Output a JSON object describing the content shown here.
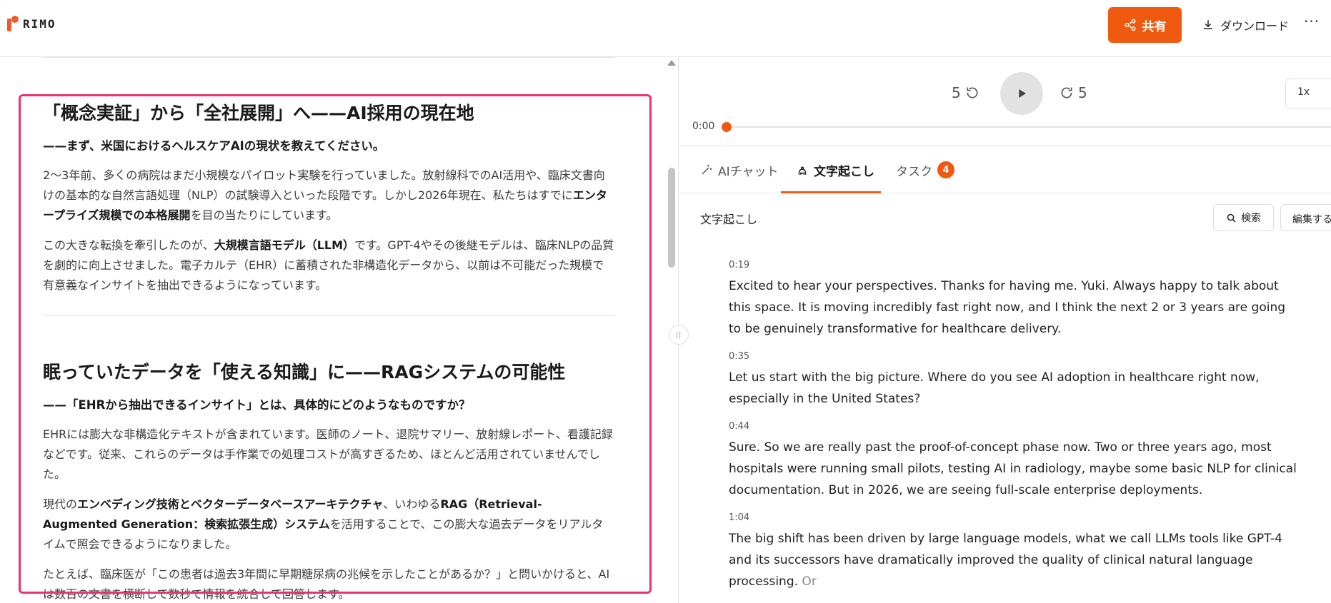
{
  "header": {
    "logo_text": "RIMO",
    "share_label": "共有",
    "download_label": "ダウンロード",
    "more_label": "···"
  },
  "article": {
    "section1": {
      "heading": "「概念実証」から「全社展開」へ——AI採用の現在地",
      "question": "——まず、米国におけるヘルスケアAIの現状を教えてください。",
      "p1_a": "2〜3年前、多くの病院はまだ小規模なパイロット実験を行っていました。放射線科でのAI活用や、臨床文書向けの基本的な自然言語処理（NLP）の試験導入といった段階です。しかし2026年現在、私たちはすでに",
      "p1_b": "エンタープライズ規模での本格展開",
      "p1_c": "を目の当たりにしています。",
      "p2_a": "この大きな転換を牽引したのが、",
      "p2_b": "大規模言語モデル（LLM）",
      "p2_c": "です。GPT-4やその後継モデルは、臨床NLPの品質を劇的に向上させました。電子カルテ（EHR）に蓄積された非構造化データから、以前は不可能だった規模で有意義なインサイトを抽出できるようになっています。"
    },
    "section2": {
      "heading": "眠っていたデータを「使える知識」に——RAGシステムの可能性",
      "question": "——「EHRから抽出できるインサイト」とは、具体的にどのようなものですか？",
      "p1": "EHRには膨大な非構造化テキストが含まれています。医師のノート、退院サマリー、放射線レポート、看護記録などです。従来、これらのデータは手作業での処理コストが高すぎるため、ほとんど活用されていませんでした。",
      "p2_a": "現代の",
      "p2_b": "エンベディング技術とベクターデータベースアーキテクチャ",
      "p2_c": "、いわゆる",
      "p2_d": "RAG（Retrieval-Augmented Generation：検索拡張生成）システム",
      "p2_e": "を活用することで、この膨大な過去データをリアルタイムで照会できるようになりました。",
      "p3": "たとえば、臨床医が「この患者は過去3年間に早期糖尿病の兆候を示したことがあるか？」と問いかけると、AIは数百の文書を横断して数秒で情報を統合して回答します。"
    }
  },
  "player": {
    "skip_back": "5",
    "skip_forward": "5",
    "speed": "1x",
    "current_time": "0:00",
    "progress": 0.0
  },
  "tabs": [
    {
      "label": "AIチャット"
    },
    {
      "label": "文字起こし"
    },
    {
      "label": "タスク",
      "badge": "4"
    }
  ],
  "transcript_panel": {
    "title": "文字起こし",
    "search_label": "検索",
    "edit_label": "編集する"
  },
  "segments": [
    {
      "time": "0:19",
      "text": "Excited to hear your perspectives. Thanks for having me. Yuki. Always happy to talk about this space. It is moving incredibly fast right now, and I think the next 2 or 3 years are going to be genuinely transformative for healthcare delivery."
    },
    {
      "time": "0:35",
      "text": " Let us start with the big picture. Where do you see AI adoption in healthcare right now, especially in the United States?"
    },
    {
      "time": "0:44",
      "text_a": " Sure. So we are really past the proof-of-concept phase now. ",
      "text_b": "Two or three years ago, most hospitals were running small pilots, testing AI in radiology, maybe some basic NLP for clinical documentation.",
      "text_c": " But in 2026, we are seeing full-scale enterprise deployments."
    },
    {
      "time": "1:04",
      "text_a": " The big shift has been driven by large language models, what we call LLMs tools like GPT-4 and its successors have dramatically improved the quality of clinical natural language processing.",
      "text_b": " Or"
    }
  ]
}
